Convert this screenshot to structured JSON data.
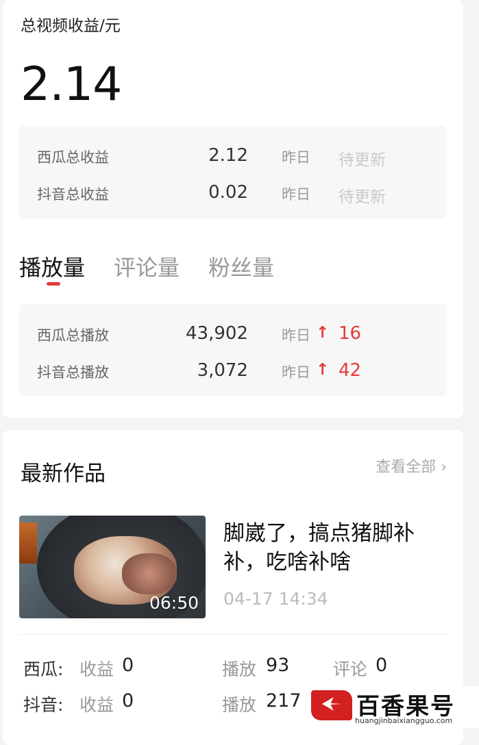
{
  "earnings": {
    "label": "总视频收益/元",
    "total": "2.14",
    "rows": [
      {
        "label": "西瓜总收益",
        "value": "2.12",
        "yesterday_label": "昨日",
        "yesterday_value": "待更新"
      },
      {
        "label": "抖音总收益",
        "value": "0.02",
        "yesterday_label": "昨日",
        "yesterday_value": "待更新"
      }
    ]
  },
  "tabs": [
    {
      "label": "播放量",
      "active": true
    },
    {
      "label": "评论量",
      "active": false
    },
    {
      "label": "粉丝量",
      "active": false
    }
  ],
  "plays": {
    "rows": [
      {
        "label": "西瓜总播放",
        "value": "43,902",
        "yesterday_label": "昨日",
        "arrow": "↑",
        "delta": "16"
      },
      {
        "label": "抖音总播放",
        "value": "3,072",
        "yesterday_label": "昨日",
        "arrow": "↑",
        "delta": "42"
      }
    ]
  },
  "latest": {
    "title": "最新作品",
    "see_all": "查看全部 ›",
    "video": {
      "title": "脚崴了，搞点猪脚补补，吃啥补啥",
      "duration": "06:50",
      "time": "04-17 14:34"
    },
    "metrics": [
      {
        "platform": "西瓜:",
        "income_label": "收益",
        "income": "0",
        "play_label": "播放",
        "play": "93",
        "comment_label": "评论",
        "comment": "0"
      },
      {
        "platform": "抖音:",
        "income_label": "收益",
        "income": "0",
        "play_label": "播放",
        "play": "217"
      }
    ]
  },
  "watermark": {
    "brand": "百香果号",
    "url": "huangjinbaixiangguo.com"
  },
  "colors": {
    "accent": "#e53935",
    "background": "#f4f4f6"
  }
}
